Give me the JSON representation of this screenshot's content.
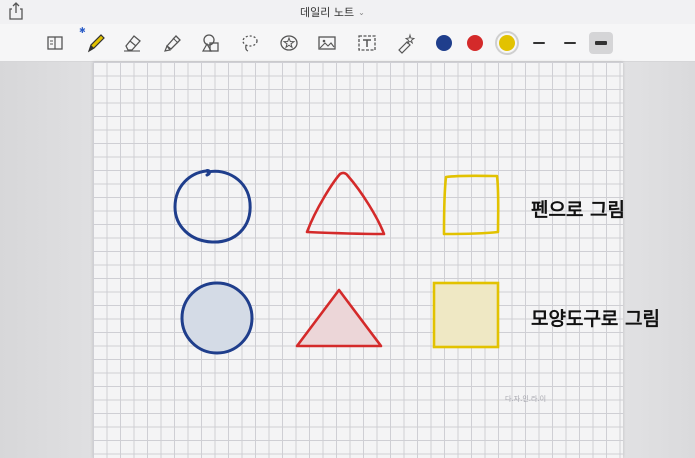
{
  "header": {
    "title": "데일리 노트",
    "share_icon": "share-icon",
    "title_chevron": "chevron-down-icon"
  },
  "toolbar": {
    "tools": [
      {
        "name": "reading-mode",
        "icon": "book-icon"
      },
      {
        "name": "pen",
        "icon": "pen-icon",
        "active": true
      },
      {
        "name": "eraser",
        "icon": "eraser-icon"
      },
      {
        "name": "highlighter",
        "icon": "highlighter-icon"
      },
      {
        "name": "shape",
        "icon": "shape-icon"
      },
      {
        "name": "lasso",
        "icon": "lasso-icon"
      },
      {
        "name": "sticker",
        "icon": "star-sticker-icon"
      },
      {
        "name": "image",
        "icon": "image-icon"
      },
      {
        "name": "text",
        "icon": "text-box-icon"
      },
      {
        "name": "laser",
        "icon": "laser-pointer-icon"
      }
    ],
    "bluetooth_icon": "bluetooth-icon",
    "colors": [
      "#1f3e8c",
      "#d42a2a",
      "#e2c200"
    ],
    "selected_color": "#e2c200",
    "stroke_widths": [
      "thin",
      "medium",
      "thick"
    ],
    "selected_stroke": "thick"
  },
  "page": {
    "captions": {
      "pen_drawing": "펜으로 그림",
      "shape_tool_drawing": "모양도구로 그림"
    },
    "watermark": "다.자.인.라.이"
  },
  "colors": {
    "blue": "#1f3e8c",
    "red": "#d42a2a",
    "yellow": "#e2c200",
    "fill_blue": "#d4dbe6",
    "fill_red": "#ecd6d8"
  }
}
